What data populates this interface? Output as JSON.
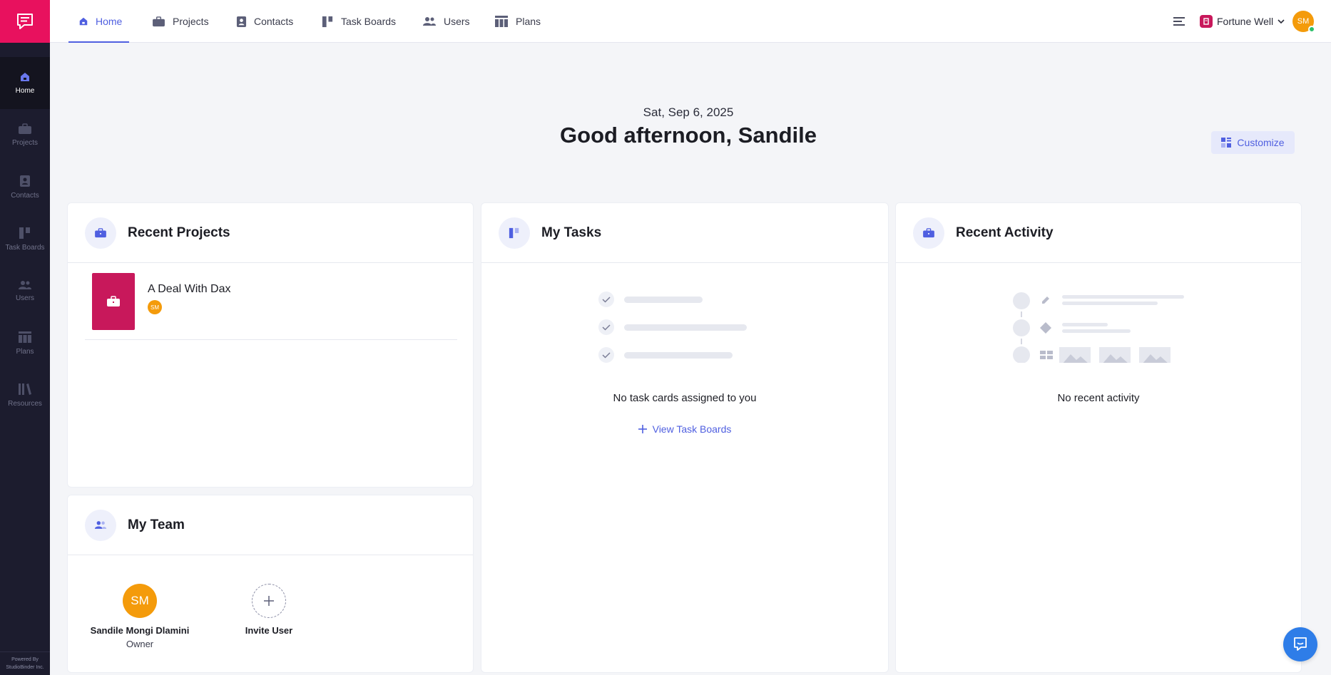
{
  "sidebar": {
    "items": [
      {
        "label": "Home",
        "icon": "home-icon"
      },
      {
        "label": "Projects",
        "icon": "briefcase-icon"
      },
      {
        "label": "Contacts",
        "icon": "contact-icon"
      },
      {
        "label": "Task Boards",
        "icon": "taskboard-icon"
      },
      {
        "label": "Users",
        "icon": "users-icon"
      },
      {
        "label": "Plans",
        "icon": "plans-icon"
      },
      {
        "label": "Resources",
        "icon": "resources-icon"
      }
    ],
    "powered_line1": "Powered By",
    "powered_line2": "StudioBinder Inc."
  },
  "topnav": {
    "tabs": [
      {
        "label": "Home",
        "icon": "home-icon"
      },
      {
        "label": "Projects",
        "icon": "briefcase-icon"
      },
      {
        "label": "Contacts",
        "icon": "contact-icon"
      },
      {
        "label": "Task Boards",
        "icon": "taskboard-icon"
      },
      {
        "label": "Users",
        "icon": "users-icon"
      },
      {
        "label": "Plans",
        "icon": "plans-icon"
      }
    ],
    "workspace_name": "Fortune Well",
    "user_initials": "SM"
  },
  "greeting": {
    "date": "Sat, Sep 6, 2025",
    "text": "Good afternoon, Sandile",
    "customize_label": "Customize"
  },
  "recent_projects": {
    "title": "Recent Projects",
    "items": [
      {
        "name": "A Deal With Dax",
        "avatar": "SM"
      }
    ]
  },
  "my_tasks": {
    "title": "My Tasks",
    "empty_text": "No task cards assigned to you",
    "view_boards_label": "View Task Boards"
  },
  "recent_activity": {
    "title": "Recent Activity",
    "empty_text": "No recent activity"
  },
  "my_team": {
    "title": "My Team",
    "members": [
      {
        "initials": "SM",
        "name": "Sandile Mongi Dlamini",
        "role": "Owner"
      }
    ],
    "invite_label": "Invite User"
  },
  "colors": {
    "brand": "#e8115e",
    "accent": "#4f5fe0",
    "sidebar_bg": "#1c1c2e",
    "avatar": "#f49b0b",
    "project": "#c8185b"
  }
}
